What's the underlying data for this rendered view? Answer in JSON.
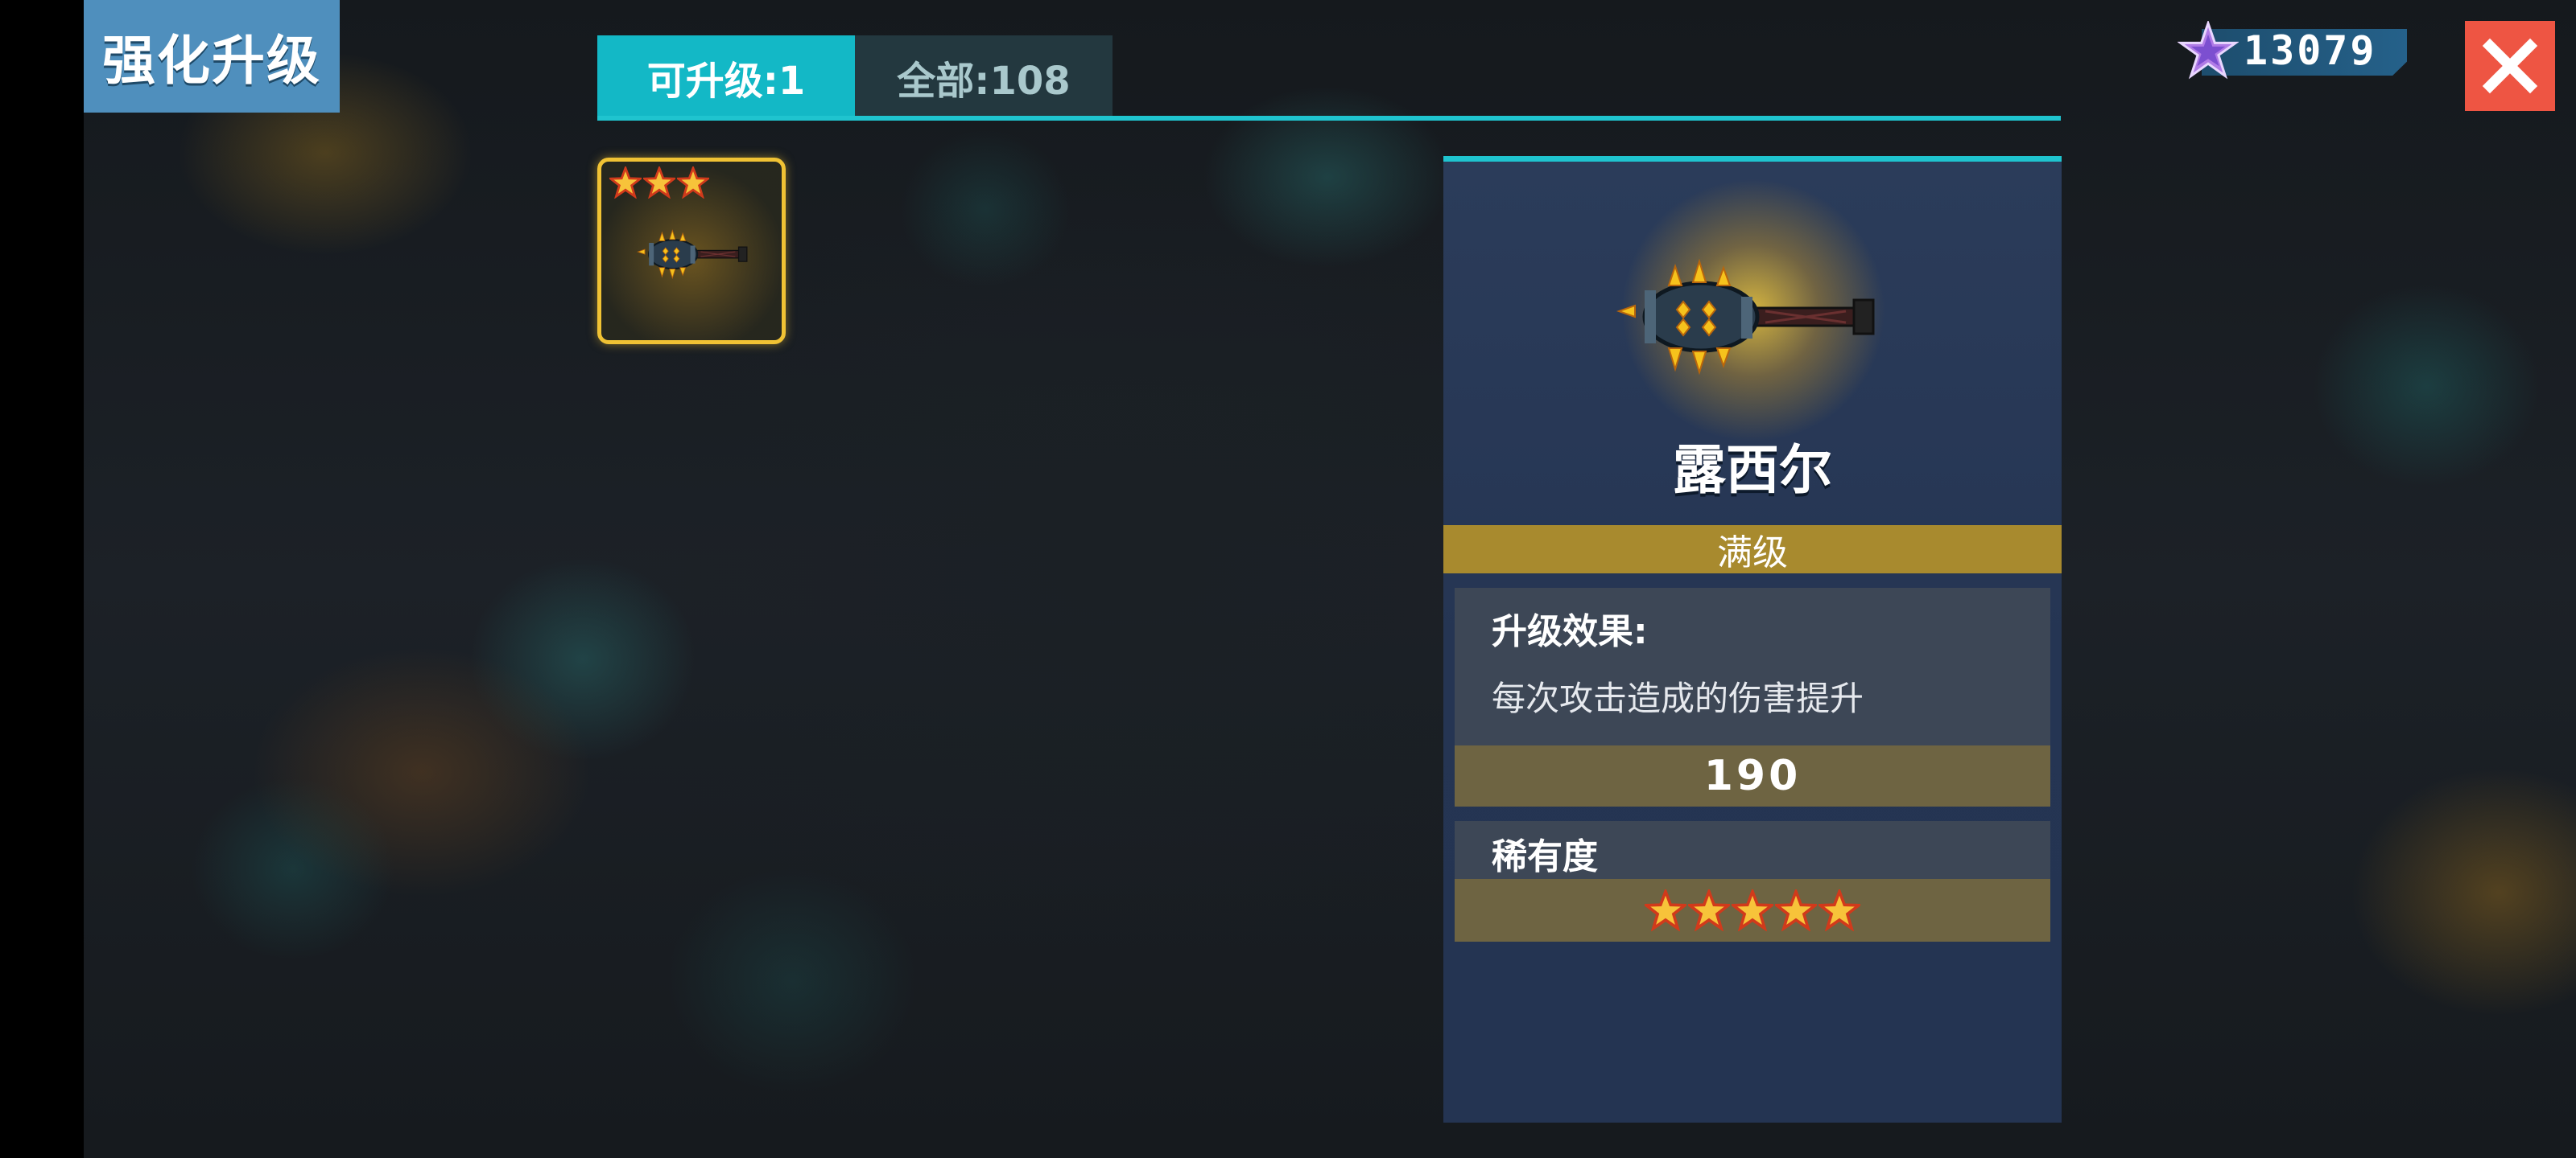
{
  "header": {
    "title": "强化升级"
  },
  "tabs": [
    {
      "label": "可升级:1",
      "active": true
    },
    {
      "label": "全部:108",
      "active": false
    }
  ],
  "currency": {
    "icon": "purple-star-gem-icon",
    "value": "13079"
  },
  "close": {
    "icon": "close-icon",
    "color": "#ee5543"
  },
  "items": [
    {
      "stars": 3,
      "icon": "spiked-mace-icon"
    }
  ],
  "detail": {
    "weapon_icon": "spiked-mace-icon",
    "name": "露西尔",
    "level_status": "满级",
    "effect_title": "升级效果:",
    "effect_desc": "每次攻击造成的伤害提升",
    "effect_value": "190",
    "rarity_title": "稀有度",
    "rarity_stars": 5
  },
  "colors": {
    "accent": "#1fc4cf",
    "title_badge": "#4f8fbd",
    "gold_bar": "#a88a2e",
    "value_bar": "#6e6442",
    "panel": "#253553"
  }
}
